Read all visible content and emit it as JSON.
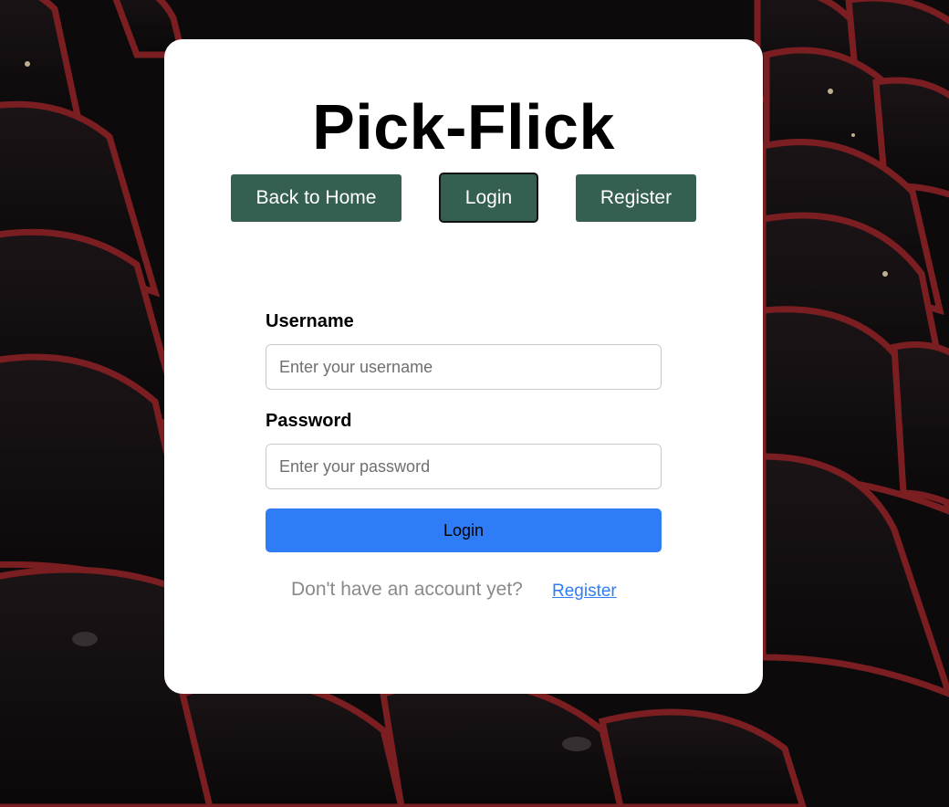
{
  "app": {
    "title": "Pick-Flick"
  },
  "nav": {
    "home_label": "Back to Home",
    "login_label": "Login",
    "register_label": "Register"
  },
  "form": {
    "username_label": "Username",
    "username_placeholder": "Enter your username",
    "username_value": "",
    "password_label": "Password",
    "password_placeholder": "Enter your password",
    "password_value": "",
    "submit_label": "Login"
  },
  "footer": {
    "prompt": "Don't have an account yet?",
    "register_link": "Register"
  },
  "colors": {
    "nav_button": "#356051",
    "submit_button": "#2f7df6",
    "link": "#2f7df6",
    "card": "#ffffff"
  },
  "background": {
    "icon": "theater-seats-photo"
  }
}
